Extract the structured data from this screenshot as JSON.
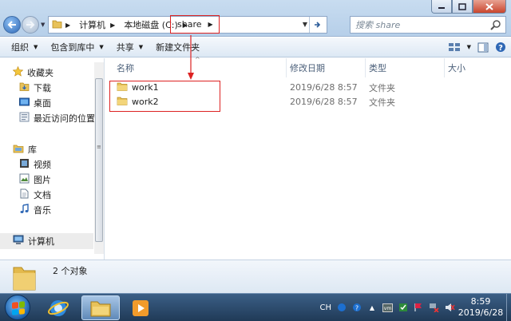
{
  "address_bar": {
    "breadcrumbs": [
      "计算机",
      "本地磁盘 (C:)",
      "share"
    ]
  },
  "search": {
    "placeholder": "搜索 share"
  },
  "toolbar": {
    "organize": "组织",
    "include_in_library": "包含到库中",
    "share": "共享",
    "new_folder": "新建文件夹"
  },
  "nav": {
    "favorites": "收藏夹",
    "downloads": "下载",
    "desktop": "桌面",
    "recent": "最近访问的位置",
    "libraries": "库",
    "videos": "视频",
    "pictures": "图片",
    "documents": "文档",
    "music": "音乐",
    "computer": "计算机"
  },
  "columns": {
    "name": "名称",
    "date": "修改日期",
    "type": "类型",
    "size": "大小"
  },
  "files": [
    {
      "name": "work1",
      "date": "2019/6/28 8:57",
      "type": "文件夹"
    },
    {
      "name": "work2",
      "date": "2019/6/28 8:57",
      "type": "文件夹"
    }
  ],
  "details": {
    "item_count": "2 个对象"
  },
  "taskbar": {
    "tray_lang": "CH",
    "time": "8:59",
    "date": "2019/6/28"
  },
  "icons": {
    "folder_color": "#e8c25a",
    "accent": "#2e67b5",
    "annotation_color": "#dd2222"
  }
}
